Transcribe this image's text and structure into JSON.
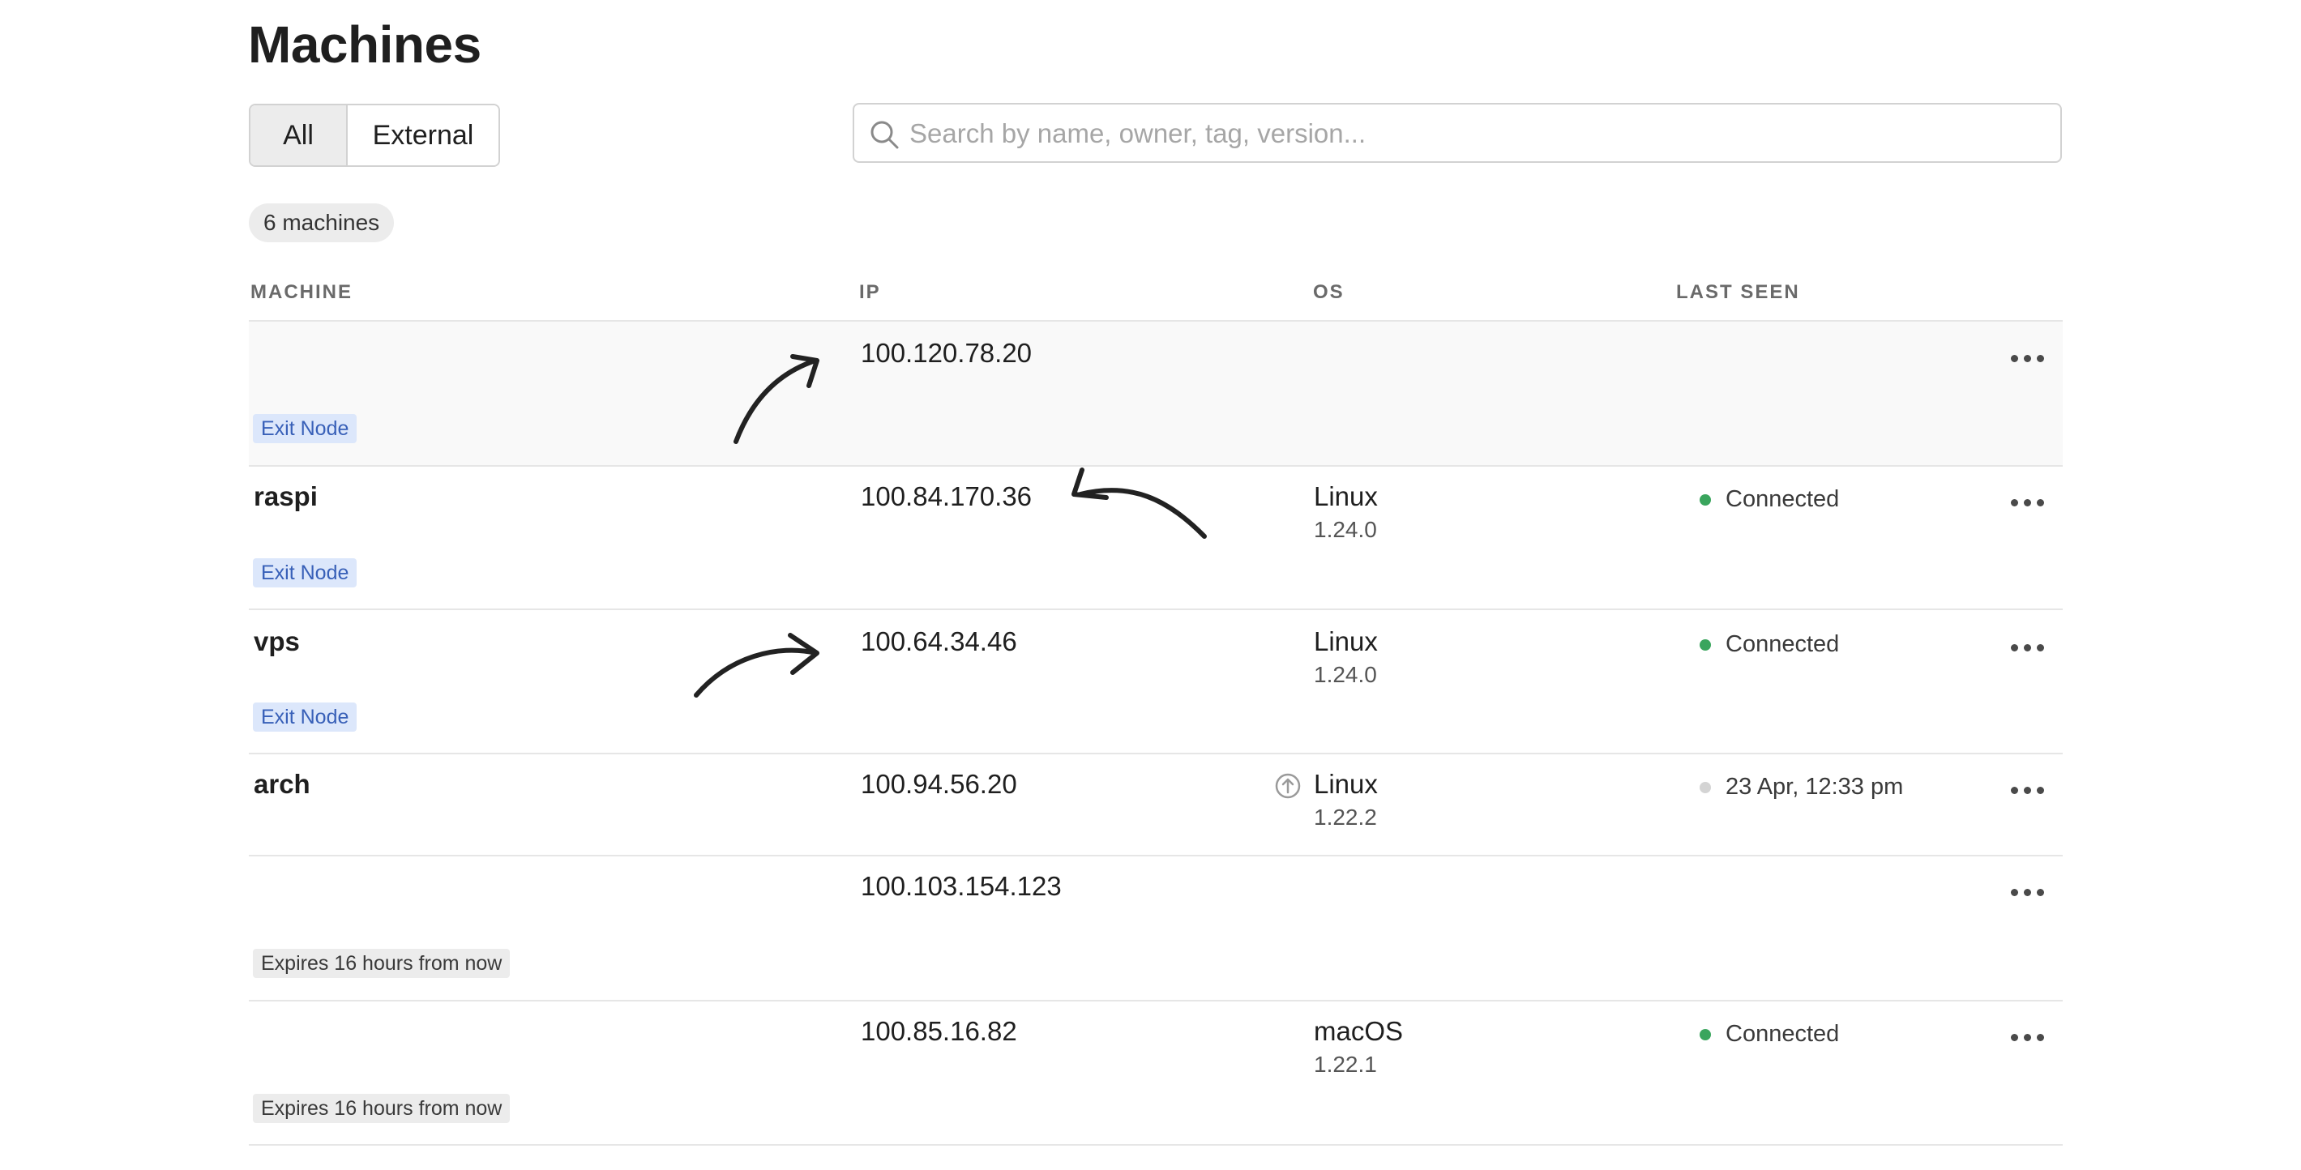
{
  "page": {
    "title": "Machines"
  },
  "filters": {
    "all_label": "All",
    "external_label": "External"
  },
  "search": {
    "placeholder": "Search by name, owner, tag, version..."
  },
  "machine_count": "6 machines",
  "table": {
    "headers": {
      "machine": "MACHINE",
      "ip": "IP",
      "os": "OS",
      "last_seen": "LAST SEEN"
    },
    "rows": [
      {
        "name": "",
        "badge": "Exit Node",
        "ip": "100.120.78.20",
        "os": "",
        "version": "",
        "last_seen": "",
        "status": "none",
        "highlighted": true
      },
      {
        "name": "raspi",
        "badge": "Exit Node",
        "ip": "100.84.170.36",
        "os": "Linux",
        "version": "1.24.0",
        "last_seen": "Connected",
        "status": "connected"
      },
      {
        "name": "vps",
        "badge": "Exit Node",
        "ip": "100.64.34.46",
        "os": "Linux",
        "version": "1.24.0",
        "last_seen": "Connected",
        "status": "connected"
      },
      {
        "name": "arch",
        "badge": "",
        "ip": "100.94.56.20",
        "os": "Linux",
        "version": "1.22.2",
        "last_seen": "23 Apr, 12:33 pm",
        "status": "offline",
        "update_available": true
      },
      {
        "name": "",
        "badge": "Expires 16 hours from now",
        "ip": "100.103.154.123",
        "os": "",
        "version": "",
        "last_seen": "",
        "status": "none"
      },
      {
        "name": "",
        "badge": "Expires 16 hours from now",
        "ip": "100.85.16.82",
        "os": "macOS",
        "version": "1.22.1",
        "last_seen": "Connected",
        "status": "connected"
      }
    ]
  },
  "colors": {
    "connected": "#3aa55d",
    "offline": "#d4d4d4",
    "exit_node_bg": "#dce7fb",
    "exit_node_text": "#3860b8",
    "row_highlight": "#f9f9f9"
  },
  "icons": {
    "search": "search-icon",
    "more": "more-horizontal-icon",
    "update": "arrow-up-circle-icon",
    "annotation": "hand-drawn-arrow-icon"
  }
}
